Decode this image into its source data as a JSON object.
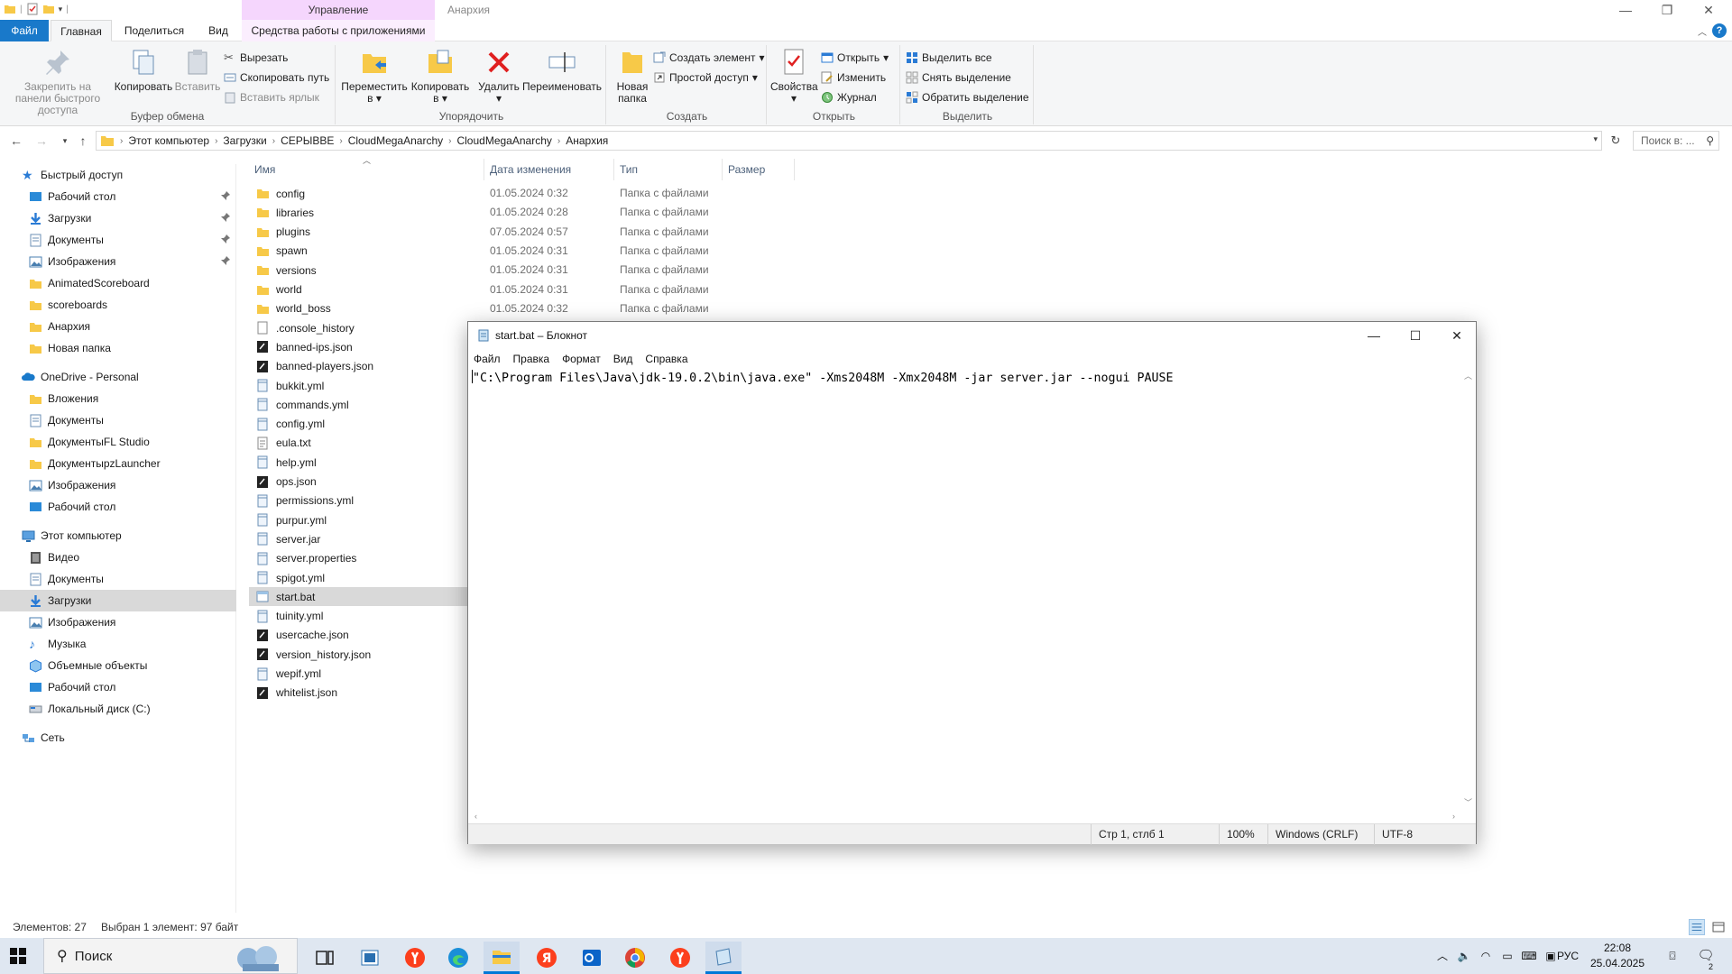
{
  "explorer": {
    "context_tab_header": "Управление",
    "window_title": "Анархия",
    "tabs": {
      "file": "Файл",
      "home": "Главная",
      "share": "Поделиться",
      "view": "Вид",
      "app_tools": "Средства работы с приложениями"
    },
    "ribbon": {
      "clipboard": {
        "label": "Буфер обмена",
        "pin": "Закрепить на панели быстрого доступа",
        "copy": "Копировать",
        "paste": "Вставить",
        "cut": "Вырезать",
        "copy_path": "Скопировать путь",
        "paste_shortcut": "Вставить ярлык"
      },
      "organize": {
        "label": "Упорядочить",
        "move_to": "Переместить в",
        "copy_to": "Копировать в",
        "delete": "Удалить",
        "rename": "Переименовать"
      },
      "create": {
        "label": "Создать",
        "new_folder": "Новая папка",
        "new_item": "Создать элемент",
        "easy_access": "Простой доступ"
      },
      "open": {
        "label": "Открыть",
        "properties": "Свойства",
        "open": "Открыть",
        "edit": "Изменить",
        "history": "Журнал"
      },
      "select": {
        "label": "Выделить",
        "select_all": "Выделить все",
        "select_none": "Снять выделение",
        "invert": "Обратить выделение"
      }
    },
    "address": {
      "crumbs": [
        "Этот компьютер",
        "Загрузки",
        "СЕРЫВВЕ",
        "CloudMegaAnarchy",
        "CloudMegaAnarchy",
        "Анархия"
      ],
      "search_placeholder": "Поиск в: ..."
    },
    "nav": {
      "quick_access": "Быстрый доступ",
      "quick_items": [
        "Рабочий стол",
        "Загрузки",
        "Документы",
        "Изображения",
        "AnimatedScoreboard",
        "scoreboards",
        "Анархия",
        "Новая папка"
      ],
      "onedrive": "OneDrive - Personal",
      "onedrive_items": [
        "Вложения",
        "Документы",
        "ДокументыFL Studio",
        "ДокументыpzLauncher",
        "Изображения",
        "Рабочий стол"
      ],
      "this_pc": "Этот компьютер",
      "pc_items": [
        "Видео",
        "Документы",
        "Загрузки",
        "Изображения",
        "Музыка",
        "Объемные объекты",
        "Рабочий стол",
        "Локальный диск (C:)"
      ],
      "network": "Сеть"
    },
    "columns": {
      "name": "Имя",
      "date": "Дата изменения",
      "type": "Тип",
      "size": "Размер"
    },
    "files": [
      {
        "name": "config",
        "date": "01.05.2024 0:32",
        "type": "Папка с файлами",
        "kind": "folder"
      },
      {
        "name": "libraries",
        "date": "01.05.2024 0:28",
        "type": "Папка с файлами",
        "kind": "folder"
      },
      {
        "name": "plugins",
        "date": "07.05.2024 0:57",
        "type": "Папка с файлами",
        "kind": "folder"
      },
      {
        "name": "spawn",
        "date": "01.05.2024 0:31",
        "type": "Папка с файлами",
        "kind": "folder"
      },
      {
        "name": "versions",
        "date": "01.05.2024 0:31",
        "type": "Папка с файлами",
        "kind": "folder"
      },
      {
        "name": "world",
        "date": "01.05.2024 0:31",
        "type": "Папка с файлами",
        "kind": "folder"
      },
      {
        "name": "world_boss",
        "date": "01.05.2024 0:32",
        "type": "Папка с файлами",
        "kind": "folder"
      },
      {
        "name": ".console_history",
        "kind": "file"
      },
      {
        "name": "banned-ips.json",
        "kind": "json"
      },
      {
        "name": "banned-players.json",
        "kind": "json"
      },
      {
        "name": "bukkit.yml",
        "kind": "yml"
      },
      {
        "name": "commands.yml",
        "kind": "yml"
      },
      {
        "name": "config.yml",
        "kind": "yml"
      },
      {
        "name": "eula.txt",
        "kind": "txt"
      },
      {
        "name": "help.yml",
        "kind": "yml"
      },
      {
        "name": "ops.json",
        "kind": "json"
      },
      {
        "name": "permissions.yml",
        "kind": "yml"
      },
      {
        "name": "purpur.yml",
        "kind": "yml"
      },
      {
        "name": "server.jar",
        "kind": "yml"
      },
      {
        "name": "server.properties",
        "kind": "yml"
      },
      {
        "name": "spigot.yml",
        "kind": "yml"
      },
      {
        "name": "start.bat",
        "kind": "bat",
        "selected": true
      },
      {
        "name": "tuinity.yml",
        "kind": "yml"
      },
      {
        "name": "usercache.json",
        "kind": "json"
      },
      {
        "name": "version_history.json",
        "kind": "json"
      },
      {
        "name": "wepif.yml",
        "kind": "yml"
      },
      {
        "name": "whitelist.json",
        "kind": "json"
      }
    ],
    "status": {
      "count": "Элементов: 27",
      "selection": "Выбран 1 элемент: 97 байт"
    }
  },
  "notepad": {
    "title": "start.bat – Блокнот",
    "menu": [
      "Файл",
      "Правка",
      "Формат",
      "Вид",
      "Справка"
    ],
    "content": "\"C:\\Program Files\\Java\\jdk-19.0.2\\bin\\java.exe\" -Xms2048M -Xmx2048M -jar server.jar --nogui PAUSE",
    "status": {
      "position": "Стр 1, стлб 1",
      "zoom": "100%",
      "line_ending": "Windows (CRLF)",
      "encoding": "UTF-8"
    }
  },
  "taskbar": {
    "search_text": "Поиск",
    "language": "РУС",
    "time": "22:08",
    "date": "25.04.2025",
    "notifications_count": "2"
  }
}
